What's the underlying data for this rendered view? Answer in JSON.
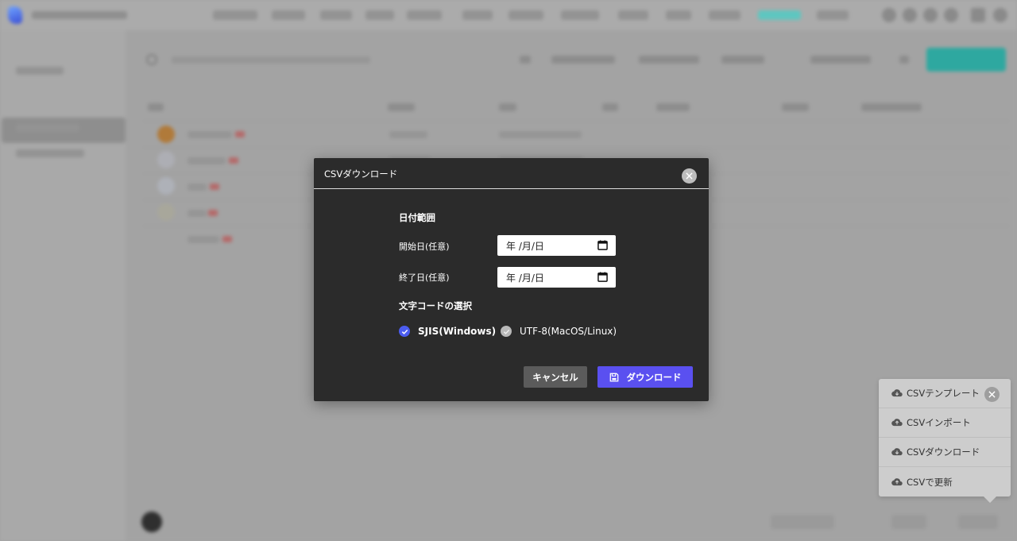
{
  "modal": {
    "title": "CSVダウンロード",
    "date_range_label": "日付範囲",
    "start_label": "開始日(任意)",
    "end_label": "終了日(任意)",
    "date_placeholder": "年 /月/日",
    "encoding_label": "文字コードの選択",
    "encodings": [
      {
        "label": "SJIS(Windows)",
        "checked": true
      },
      {
        "label": "UTF-8(MacOS/Linux)",
        "checked": false
      }
    ],
    "cancel_label": "キャンセル",
    "download_label": "ダウンロード",
    "icons": {
      "close": "close-icon",
      "calendar": "calendar-icon",
      "save": "floppy-disk-icon",
      "check": "check-icon"
    }
  },
  "csv_menu": {
    "items": [
      {
        "label": "CSVテンプレート",
        "icon": "cloud-download-icon"
      },
      {
        "label": "CSVインポート",
        "icon": "cloud-upload-icon"
      },
      {
        "label": "CSVダウンロード",
        "icon": "cloud-download-icon"
      },
      {
        "label": "CSVで更新",
        "icon": "cloud-upload-icon"
      }
    ]
  },
  "colors": {
    "modal_bg": "#2b2b2b",
    "primary": "#5a50f0",
    "radio_checked": "#4b5cf0",
    "cancel_bg": "#5b5b5b",
    "menu_bg": "#cdcdcd",
    "accent_teal": "#2ea8a0"
  }
}
